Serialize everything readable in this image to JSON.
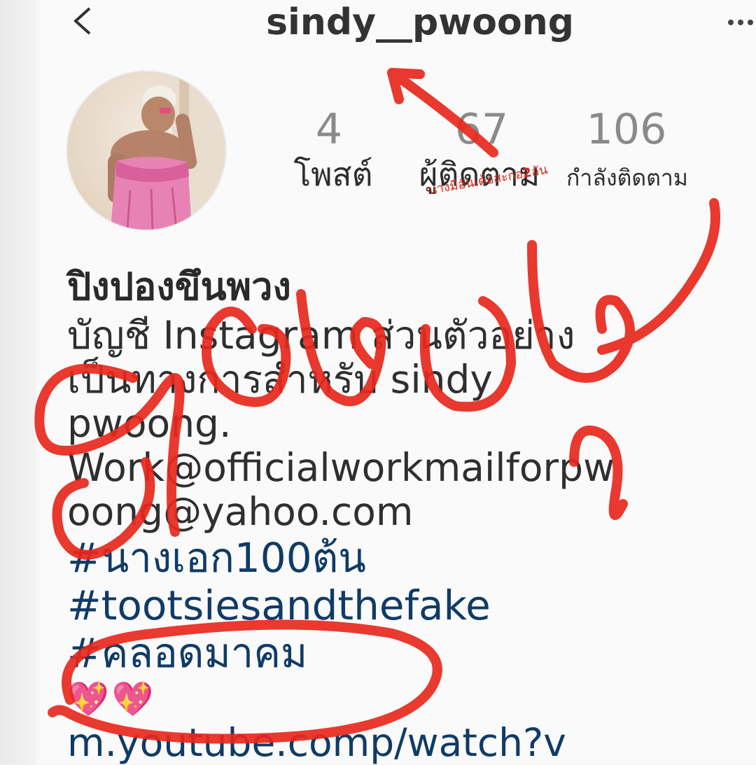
{
  "header": {
    "back_icon": "chevron-left-icon",
    "username": "sindy__pwoong",
    "more_icon": "more-horizontal-icon"
  },
  "stats": [
    {
      "value": "4",
      "label": "โพสต์"
    },
    {
      "value": "67",
      "label": "ผู้ติดตาม"
    },
    {
      "value": "106",
      "label": "กำลังติดตาม"
    }
  ],
  "annotation": {
    "note_text": "นางมีอันเด้อสะกอ",
    "note_number": "2",
    "note_suffix": "อัน",
    "watermark_text": "ก๊อปปุย",
    "color": "#e8281c"
  },
  "bio": {
    "name": "ปิงปองขึนพวง",
    "lines": [
      "บัญชี Instagram ส่วนตัวอย่าง",
      "เป็นทางการสำหรับ sindy",
      "pwoong.",
      "Work@officialworkmailforpw",
      "oong@yahoo.com"
    ],
    "hashtags": [
      "#นางเอก100ต้น",
      "#tootsiesandthefake",
      "#คลอดมาคม"
    ],
    "emoji": "💖💖",
    "link": "m.youtube.comp/watch?v"
  }
}
